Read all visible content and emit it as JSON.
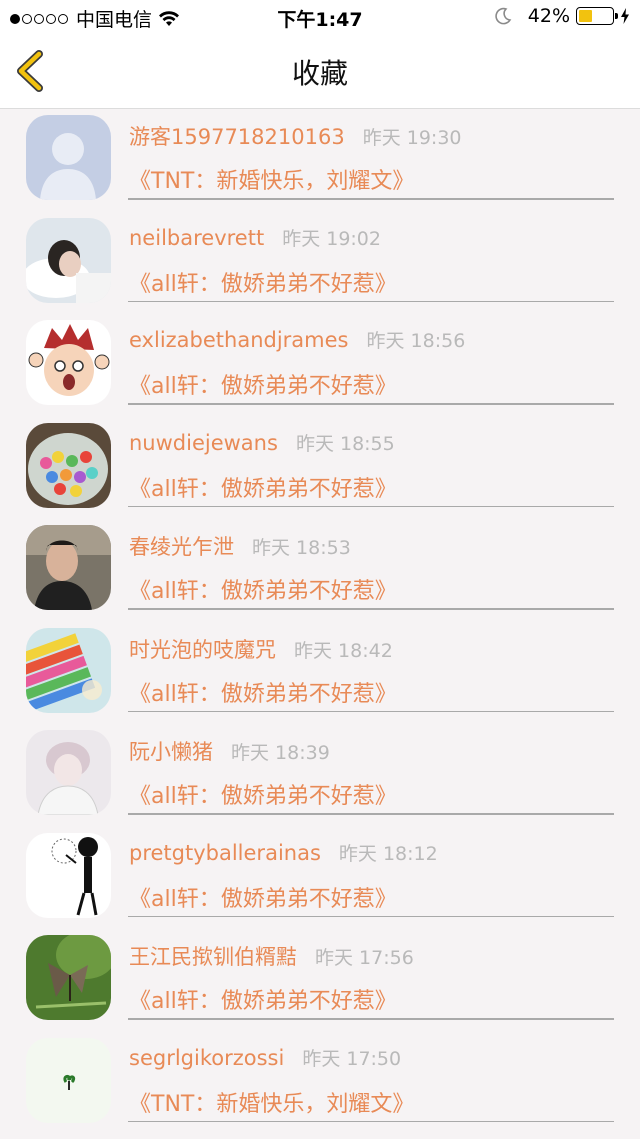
{
  "status_bar": {
    "signal_dots": [
      true,
      false,
      false,
      false,
      false
    ],
    "carrier": "中国电信",
    "wifi_icon": "wifi-icon",
    "time": "下午1:47",
    "moon_icon": "moon-icon",
    "battery_percent": "42%",
    "battery_level": 0.42,
    "battery_color": "#f2c20f",
    "charging_icon": "bolt-icon"
  },
  "nav": {
    "back_icon": "chevron-left-icon",
    "title": "收藏",
    "accent_color": "#f2c20f"
  },
  "colors": {
    "orange_text": "#e88a56",
    "time_gray": "#b9b9b9"
  },
  "favorites": [
    {
      "user": "游客1597718210163",
      "time": "昨天 19:30",
      "title": "《TNT：新婚快乐，刘耀文》"
    },
    {
      "user": "neilbarevrett",
      "time": "昨天 19:02",
      "title": "《all轩：傲娇弟弟不好惹》"
    },
    {
      "user": "exlizabethandjrames",
      "time": "昨天 18:56",
      "title": "《all轩：傲娇弟弟不好惹》"
    },
    {
      "user": "nuwdiejewans",
      "time": "昨天 18:55",
      "title": "《all轩：傲娇弟弟不好惹》"
    },
    {
      "user": "春绫光乍泄",
      "time": "昨天 18:53",
      "title": "《all轩：傲娇弟弟不好惹》"
    },
    {
      "user": "时光泡的吱魔咒",
      "time": "昨天 18:42",
      "title": "《all轩：傲娇弟弟不好惹》"
    },
    {
      "user": "阮小懒猪",
      "time": "昨天 18:39",
      "title": "《all轩：傲娇弟弟不好惹》"
    },
    {
      "user": "pretgtyballerainas",
      "time": "昨天 18:12",
      "title": "《all轩：傲娇弟弟不好惹》"
    },
    {
      "user": "王江民揿钏伯糈黠",
      "time": "昨天 17:56",
      "title": "《all轩：傲娇弟弟不好惹》"
    },
    {
      "user": "segrlgikorzossi",
      "time": "昨天 17:50",
      "title": "《TNT：新婚快乐，刘耀文》"
    }
  ]
}
